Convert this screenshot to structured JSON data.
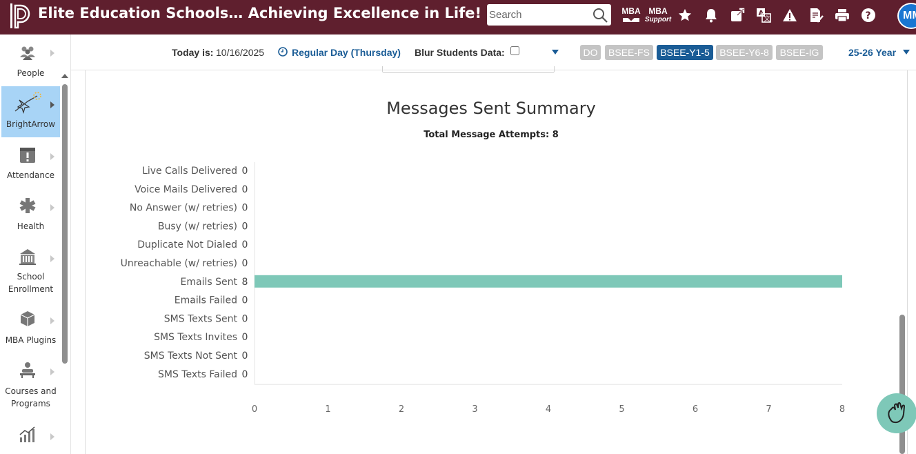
{
  "header": {
    "app_title": "Elite Education Schools… Achieving Excellence in Life!",
    "search_placeholder": "Search",
    "mba_label": "MBA",
    "mba_support_top": "MBA",
    "mba_support_bottom": "Support",
    "avatar_initials": "MM"
  },
  "sidebar": {
    "items": [
      {
        "label": "People",
        "icon": "people-icon"
      },
      {
        "label": "BrightArrow",
        "icon": "brightarrow-icon",
        "active": true
      },
      {
        "label": "Attendance",
        "icon": "attendance-icon"
      },
      {
        "label": "Health",
        "icon": "health-icon"
      },
      {
        "label_line1": "School",
        "label_line2": "Enrollment",
        "icon": "school-icon"
      },
      {
        "label": "MBA Plugins",
        "icon": "plugins-icon"
      },
      {
        "label_line1": "Courses and",
        "label_line2": "Programs",
        "icon": "courses-icon"
      },
      {
        "label": "",
        "icon": "reports-icon"
      }
    ]
  },
  "subheader": {
    "today_label": "Today is:",
    "today_value": "10/16/2025",
    "day_type": "Regular Day (Thursday)",
    "blur_label": "Blur Students Data:",
    "schools": [
      "DO",
      "BSEE-FS",
      "BSEE-Y1-5",
      "BSEE-Y6-8",
      "BSEE-IG"
    ],
    "active_school": "BSEE-Y1-5",
    "year": "25-26 Year"
  },
  "colors": {
    "header_bg": "#5f1f2e",
    "accent": "#1a5c96",
    "bar": "#7ec8b8",
    "active_nav": "#a8d4f6"
  },
  "chart_data": {
    "type": "bar",
    "orientation": "horizontal",
    "title": "Messages Sent Summary",
    "subtitle": "Total Message Attempts: 8",
    "categories": [
      "Live Calls Delivered",
      "Voice Mails Delivered",
      "No Answer (w/ retries)",
      "Busy (w/ retries)",
      "Duplicate Not Dialed",
      "Unreachable (w/ retries)",
      "Emails Sent",
      "Emails Failed",
      "SMS Texts Sent",
      "SMS Texts Invites",
      "SMS Texts Not Sent",
      "SMS Texts Failed"
    ],
    "values": [
      0,
      0,
      0,
      0,
      0,
      0,
      8,
      0,
      0,
      0,
      0,
      0
    ],
    "xlim": [
      0,
      8
    ],
    "xticks": [
      0,
      1,
      2,
      3,
      4,
      5,
      6,
      7,
      8
    ],
    "grid": false,
    "legend": "none"
  }
}
